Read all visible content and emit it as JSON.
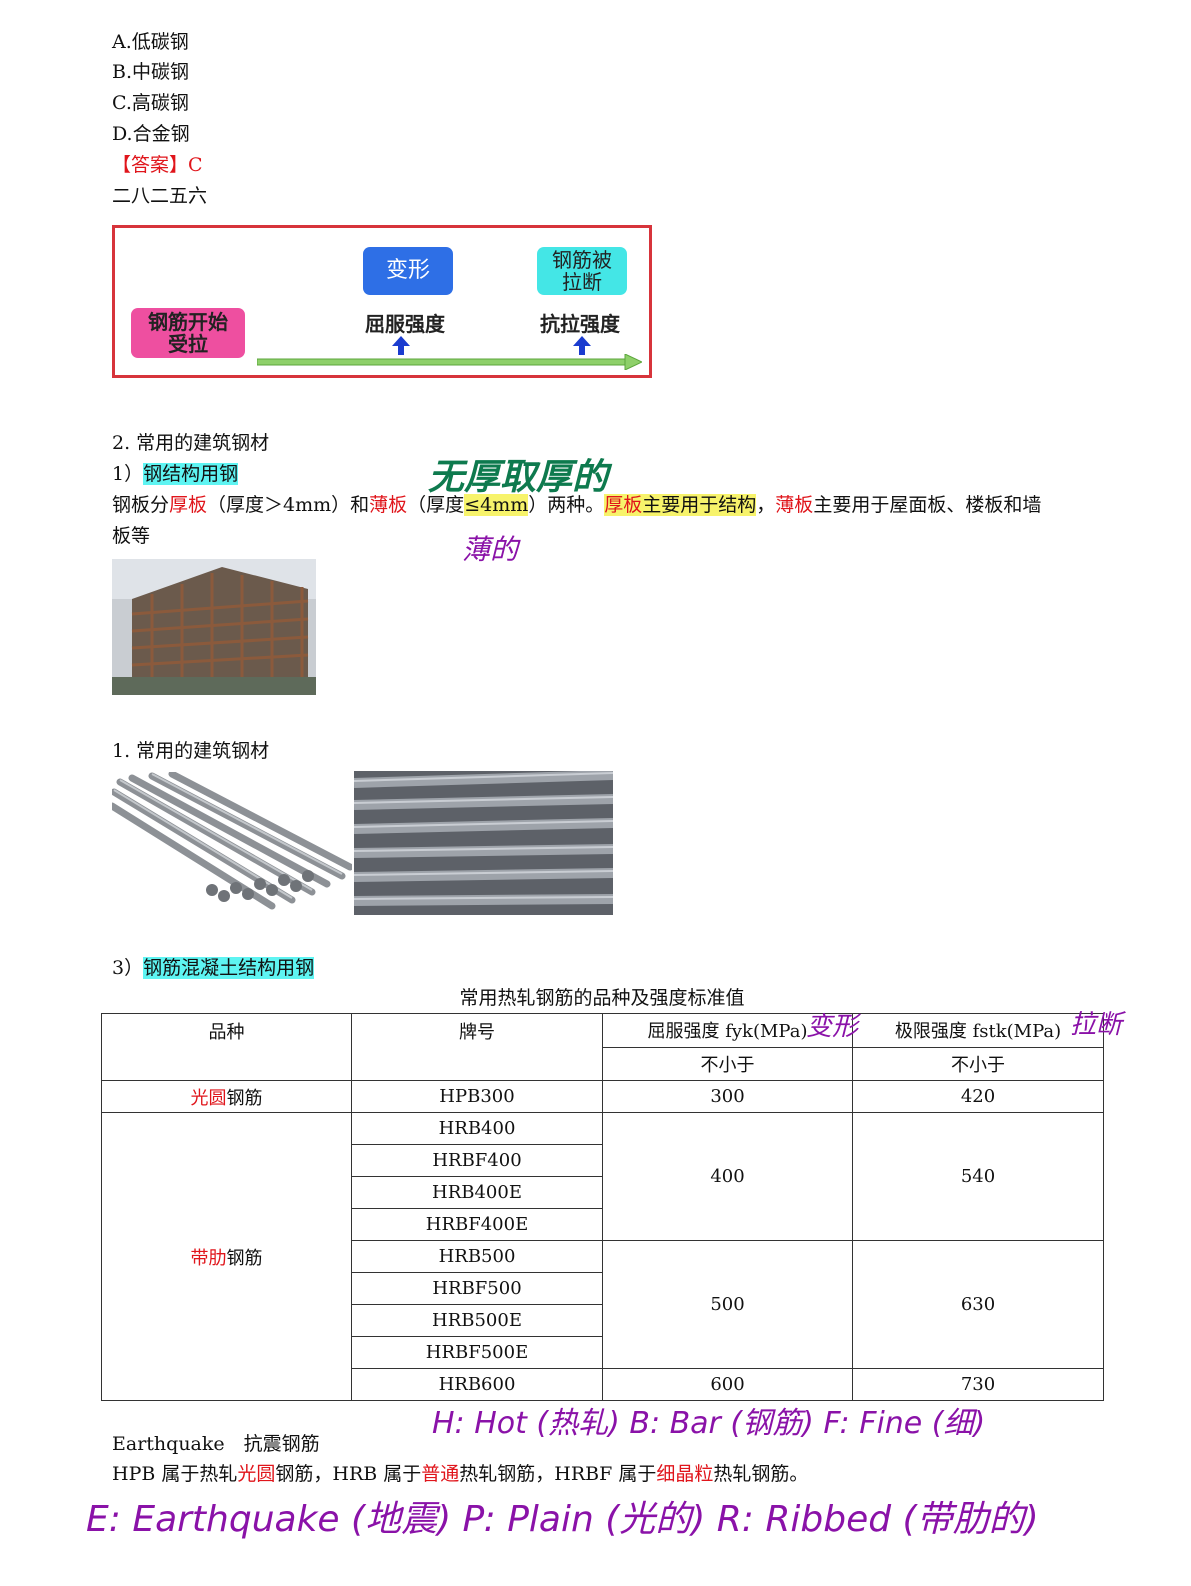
{
  "options": [
    {
      "letter": "A.",
      "text": "低碳钢"
    },
    {
      "letter": "B.",
      "text": "中碳钢"
    },
    {
      "letter": "C.",
      "text": "高碳钢"
    },
    {
      "letter": "D.",
      "text": "合金钢"
    }
  ],
  "answer": {
    "label": "【答案】",
    "value": "C"
  },
  "code_line": "二八二五六",
  "diagram": {
    "box_start": "钢筋开始\n受拉",
    "box_deform": "变形",
    "box_break": "钢筋被\n拉断",
    "label_yield": "屈服强度",
    "label_tensile": "抗拉强度",
    "colors": {
      "border": "#d7343b",
      "start_box": "#ee4fa0",
      "deform_box": "#2e6fe6",
      "break_box": "#44e6e6",
      "arrow": "#1b3ccf",
      "bar": "#8ed06a"
    }
  },
  "section2": {
    "heading": "2. 常用的建筑钢材",
    "sub1_prefix": "1）",
    "sub1_title": "钢结构用钢",
    "para_p1": "钢板分",
    "thick": "厚板",
    "para_p2": "（厚度＞4mm）和",
    "thin": "薄板",
    "para_p3": "（厚度",
    "thin_cond": "≤4mm",
    "para_p4": "）两种。",
    "thick2": "厚板",
    "hl_text": "主要用于结构",
    "comma": "，",
    "thin2": "薄板",
    "para_p5": "主要用于屋面板、楼板和墙",
    "para_line2": "板等"
  },
  "section1": {
    "heading": "1. 常用的建筑钢材"
  },
  "section3": {
    "prefix": "3）",
    "title": "钢筋混凝土结构用钢",
    "table_caption": "常用热轧钢筋的品种及强度标准值"
  },
  "table": {
    "h_variety": "品种",
    "h_grade": "牌号",
    "h_yield": "屈服强度 fyk(MPa)",
    "h_ultimate": "极限强度 fstk(MPa)",
    "h_min1": "不小于",
    "h_min2": "不小于",
    "round_red": "光圆",
    "round_rest": "钢筋",
    "ribbed_red": "带肋",
    "ribbed_rest": "钢筋",
    "hpb300": "HPB300",
    "hpb_yield": "300",
    "hpb_ult": "420",
    "g400": [
      "HRB400",
      "HRBF400",
      "HRB400E",
      "HRBF400E"
    ],
    "y400": "400",
    "u540": "540",
    "g500": [
      "HRB500",
      "HRBF500",
      "HRB500E",
      "HRBF500E"
    ],
    "y500": "500",
    "u630": "630",
    "hrb600": "HRB600",
    "y600": "600",
    "u730": "730"
  },
  "footer": {
    "earthquake_line": "Earthquake　抗震钢筋",
    "s_p1": "HPB 属于热轧",
    "s_r1": "光圆",
    "s_p2": "钢筋，HRB 属于",
    "s_r2": "普通",
    "s_p3": "热轧钢筋，HRBF 属于",
    "s_r3": "细晶粒",
    "s_p4": "热轧钢筋。"
  },
  "handwriting": {
    "top_green": "无厚取厚的",
    "under_thin": "薄的",
    "near_yield": "变形",
    "near_ultimate": "拉断",
    "hbf_line": "H: Hot (热轧)  B: Bar (钢筋)  F: Fine (细)",
    "epr_line": "E: Earthquake (地震)   P: Plain (光的)   R: Ribbed (带肋的)",
    "ink_color": "#8a12a8",
    "green_color": "#0e7a4e"
  }
}
